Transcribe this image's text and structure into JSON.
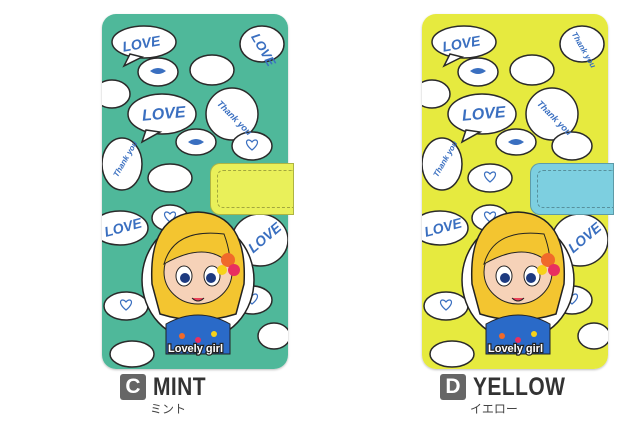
{
  "products": [
    {
      "letter": "C",
      "name": "MINT",
      "kana": "ミント",
      "background_color": "#4fb89a",
      "strap_color": "#e9f05a"
    },
    {
      "letter": "D",
      "name": "YELLOW",
      "kana": "イエロー",
      "background_color": "#e6ea3f",
      "strap_color": "#7dcfe0"
    }
  ],
  "bubble_words": [
    "LOVE",
    "Thank you"
  ],
  "character_label": "Lovely girl",
  "colors": {
    "accent_text": "#3a6fc0",
    "badge": "#666666"
  }
}
